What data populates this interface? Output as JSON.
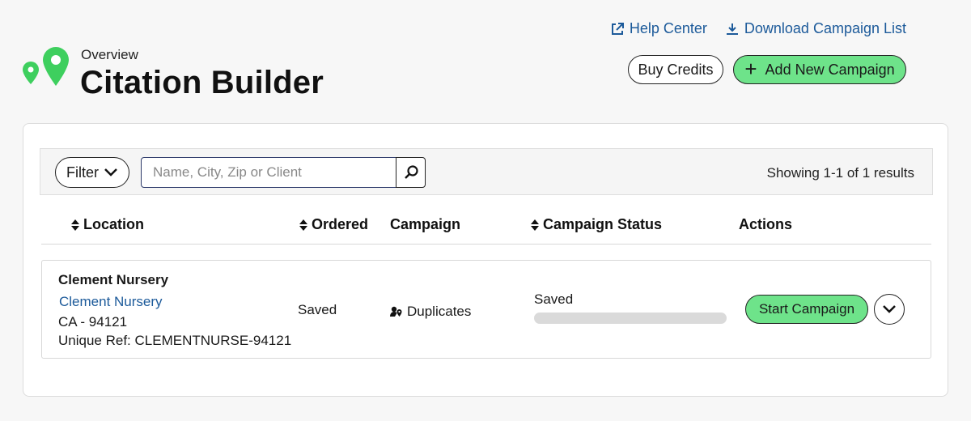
{
  "header": {
    "overview": "Overview",
    "title": "Citation Builder",
    "help_link": "Help Center",
    "download_link": "Download Campaign List",
    "buy_credits": "Buy Credits",
    "add_campaign": "Add New Campaign"
  },
  "toolbar": {
    "filter_label": "Filter",
    "search_placeholder": "Name, City, Zip or Client",
    "search_value": "",
    "results_text": "Showing 1-1 of 1 results"
  },
  "table": {
    "columns": {
      "location": "Location",
      "ordered": "Ordered",
      "campaign": "Campaign",
      "status": "Campaign Status",
      "actions": "Actions"
    },
    "rows": [
      {
        "name": "Clement Nursery",
        "link": "Clement Nursery",
        "region": "CA - 94121",
        "ref": "Unique Ref: CLEMENTNURSE-94121",
        "ordered": "Saved",
        "campaign": "Duplicates",
        "status": "Saved",
        "progress": 0,
        "action": "Start Campaign"
      }
    ]
  },
  "colors": {
    "accent_green": "#6ee38a",
    "link_blue": "#1c5a9a",
    "logo_green": "#3ecf5e"
  },
  "icons": {
    "logo": "map-pins-icon",
    "help": "external-link-icon",
    "download": "download-icon",
    "add": "plus-icon",
    "filter": "chevron-down-icon",
    "search": "search-icon",
    "sort": "sort-icon",
    "campaign": "user-pin-icon",
    "expand": "chevron-down-icon"
  }
}
